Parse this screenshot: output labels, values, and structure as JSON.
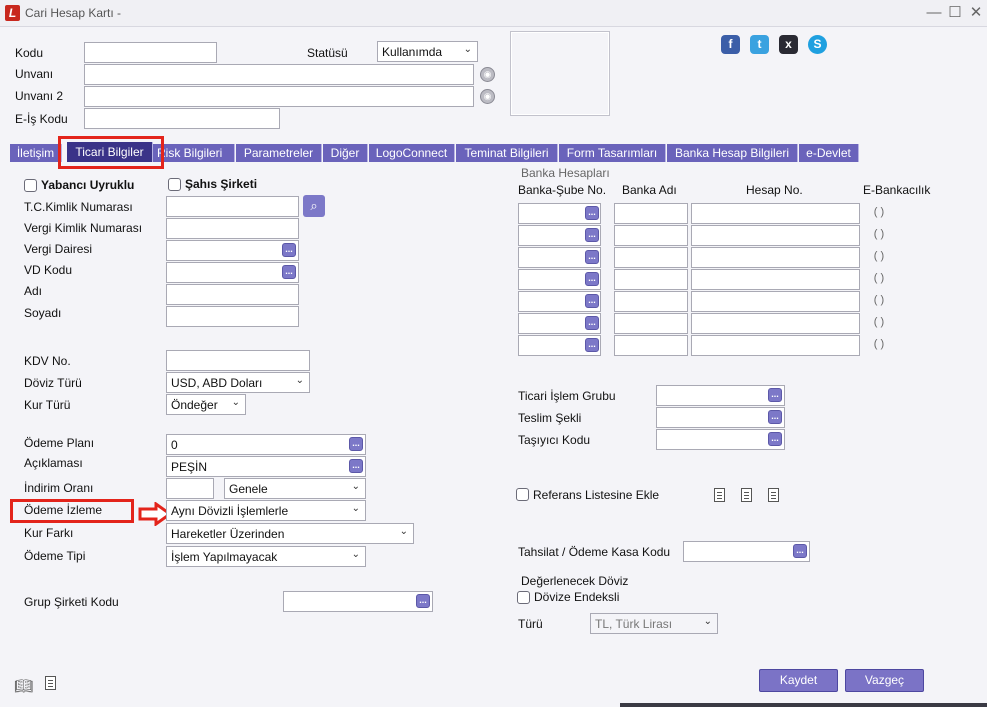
{
  "window": {
    "title": "Cari Hesap Kartı -",
    "min": "—",
    "max": "☐",
    "close": "✕"
  },
  "header": {
    "kodu_label": "Kodu",
    "kodu_value": "",
    "statusu_label": "Statüsü",
    "statusu_value": "Kullanımda",
    "unvani_label": "Unvanı",
    "unvani_value": "",
    "unvani2_label": "Unvanı 2",
    "unvani2_value": "",
    "eis_label": "E-İş Kodu",
    "eis_value": ""
  },
  "social": {
    "facebook": "f",
    "twitter": "t",
    "other": "x",
    "skype": "S"
  },
  "tabs": [
    "İletişim",
    "Ticari Bilgiler",
    "Risk Bilgileri",
    "Parametreler",
    "Diğer",
    "LogoConnect",
    "Teminat Bilgileri",
    "Form Tasarımları",
    "Banka Hesap Bilgileri",
    "e-Devlet"
  ],
  "active_tab_label": "Ticari Bilgiler",
  "left": {
    "yabanci": "Yabancı Uyruklu",
    "sahis": "Şahıs Şirketi",
    "tc_label": "T.C.Kimlik Numarası",
    "vkn_label": "Vergi Kimlik Numarası",
    "vd_label": "Vergi Dairesi",
    "vdkodu_label": "VD Kodu",
    "adi_label": "Adı",
    "soyadi_label": "Soyadı",
    "kdv_label": "KDV No.",
    "doviz_label": "Döviz Türü",
    "doviz_value": "USD, ABD Doları",
    "kur_label": "Kur Türü",
    "kur_value": "Öndeğer",
    "odeme_plani_label": "Ödeme Planı",
    "odeme_plani_value": "0",
    "aciklama_label": "Açıklaması",
    "aciklama_value": "PEŞİN",
    "indirim_label": "İndirim Oranı",
    "indirim_value": "",
    "indirim_tip": "Genele",
    "odeme_izleme_label": "Ödeme İzleme",
    "odeme_izleme_value": "Aynı Dövizli İşlemlerle",
    "kur_farki_label": "Kur Farkı",
    "kur_farki_value": "Hareketler Üzerinden",
    "odeme_tipi_label": "Ödeme Tipi",
    "odeme_tipi_value": "İşlem Yapılmayacak",
    "grup_label": "Grup Şirketi Kodu"
  },
  "bank": {
    "section_title": "Banka Hesapları",
    "col_sube": "Banka-Şube No.",
    "col_adi": "Banka Adı",
    "col_hesap": "Hesap No.",
    "col_ebank": "E-Bankacılık",
    "rows": 7
  },
  "right": {
    "ticari_label": "Ticari İşlem Grubu",
    "teslim_label": "Teslim Şekli",
    "tasiyici_label": "Taşıyıcı Kodu",
    "referans_label": "Referans Listesine Ekle",
    "tahsilat_label": "Tahsilat / Ödeme Kasa Kodu",
    "degerlenecek_label": "Değerlenecek Döviz",
    "endeksli_label": "Dövize Endeksli",
    "turu_label": "Türü",
    "turu_value": "TL, Türk Lirası"
  },
  "buttons": {
    "save": "Kaydet",
    "cancel": "Vazgeç"
  },
  "colors": {
    "tab": "#6a63bb",
    "tab_active": "#3a3388",
    "highlight": "#e3241b",
    "button": "#7b73c6"
  }
}
